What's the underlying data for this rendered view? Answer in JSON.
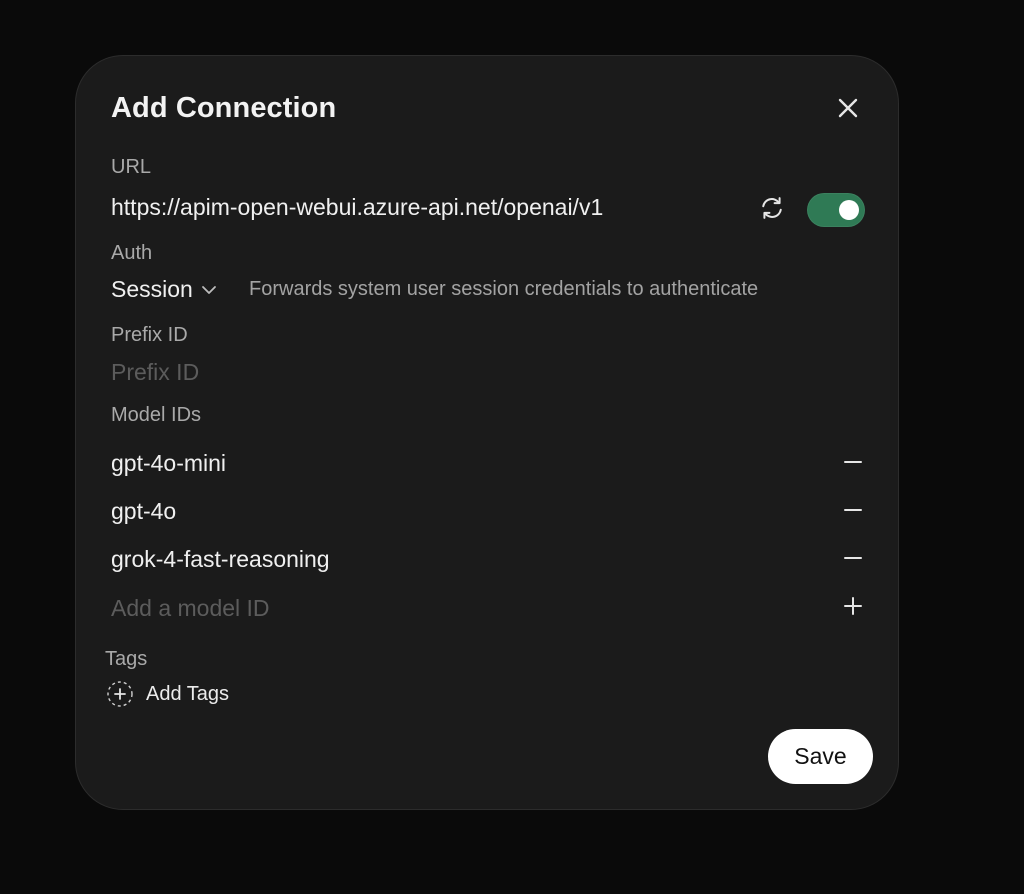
{
  "dialog": {
    "title": "Add Connection"
  },
  "url": {
    "label": "URL",
    "value": "https://apim-open-webui.azure-api.net/openai/v1",
    "enabled": true
  },
  "auth": {
    "label": "Auth",
    "selected": "Session",
    "description": "Forwards system user session credentials to authenticate"
  },
  "prefix": {
    "label": "Prefix ID",
    "placeholder": "Prefix ID",
    "value": ""
  },
  "models": {
    "label": "Model IDs",
    "items": [
      "gpt-4o-mini",
      "gpt-4o",
      "grok-4-fast-reasoning"
    ],
    "add_placeholder": "Add a model ID"
  },
  "tags": {
    "label": "Tags",
    "add_label": "Add Tags"
  },
  "actions": {
    "save_label": "Save"
  },
  "icons": {
    "close": "close-icon",
    "refresh": "refresh-icon",
    "chevron": "chevron-down-icon",
    "minus": "minus-icon",
    "plus": "plus-icon",
    "add_tag": "plus-circle-dashed-icon"
  },
  "colors": {
    "background": "#0a0a0a",
    "modal": "#1b1b1b",
    "toggle_on": "#2f7a55",
    "save_button": "#ffffff"
  }
}
